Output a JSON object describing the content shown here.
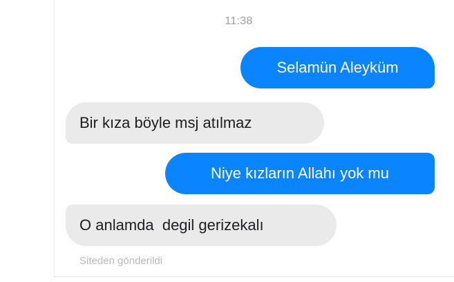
{
  "conversation": {
    "timestamp": "11:38",
    "messages": [
      {
        "direction": "sent",
        "text": "Selamün Aleyküm"
      },
      {
        "direction": "received",
        "text": "Bir kıza böyle msj atılmaz"
      },
      {
        "direction": "sent",
        "text": "Niye kızların Allahı yok mu"
      },
      {
        "direction": "received",
        "text": "O anlamda  degil gerizekalı"
      }
    ],
    "footer_note": "Siteden gönderildi"
  },
  "colors": {
    "sent_bubble": "#0a84ff",
    "received_bubble": "#eaeaea",
    "timestamp_text": "#9ba0a6",
    "footer_text": "#b6b9bd"
  }
}
